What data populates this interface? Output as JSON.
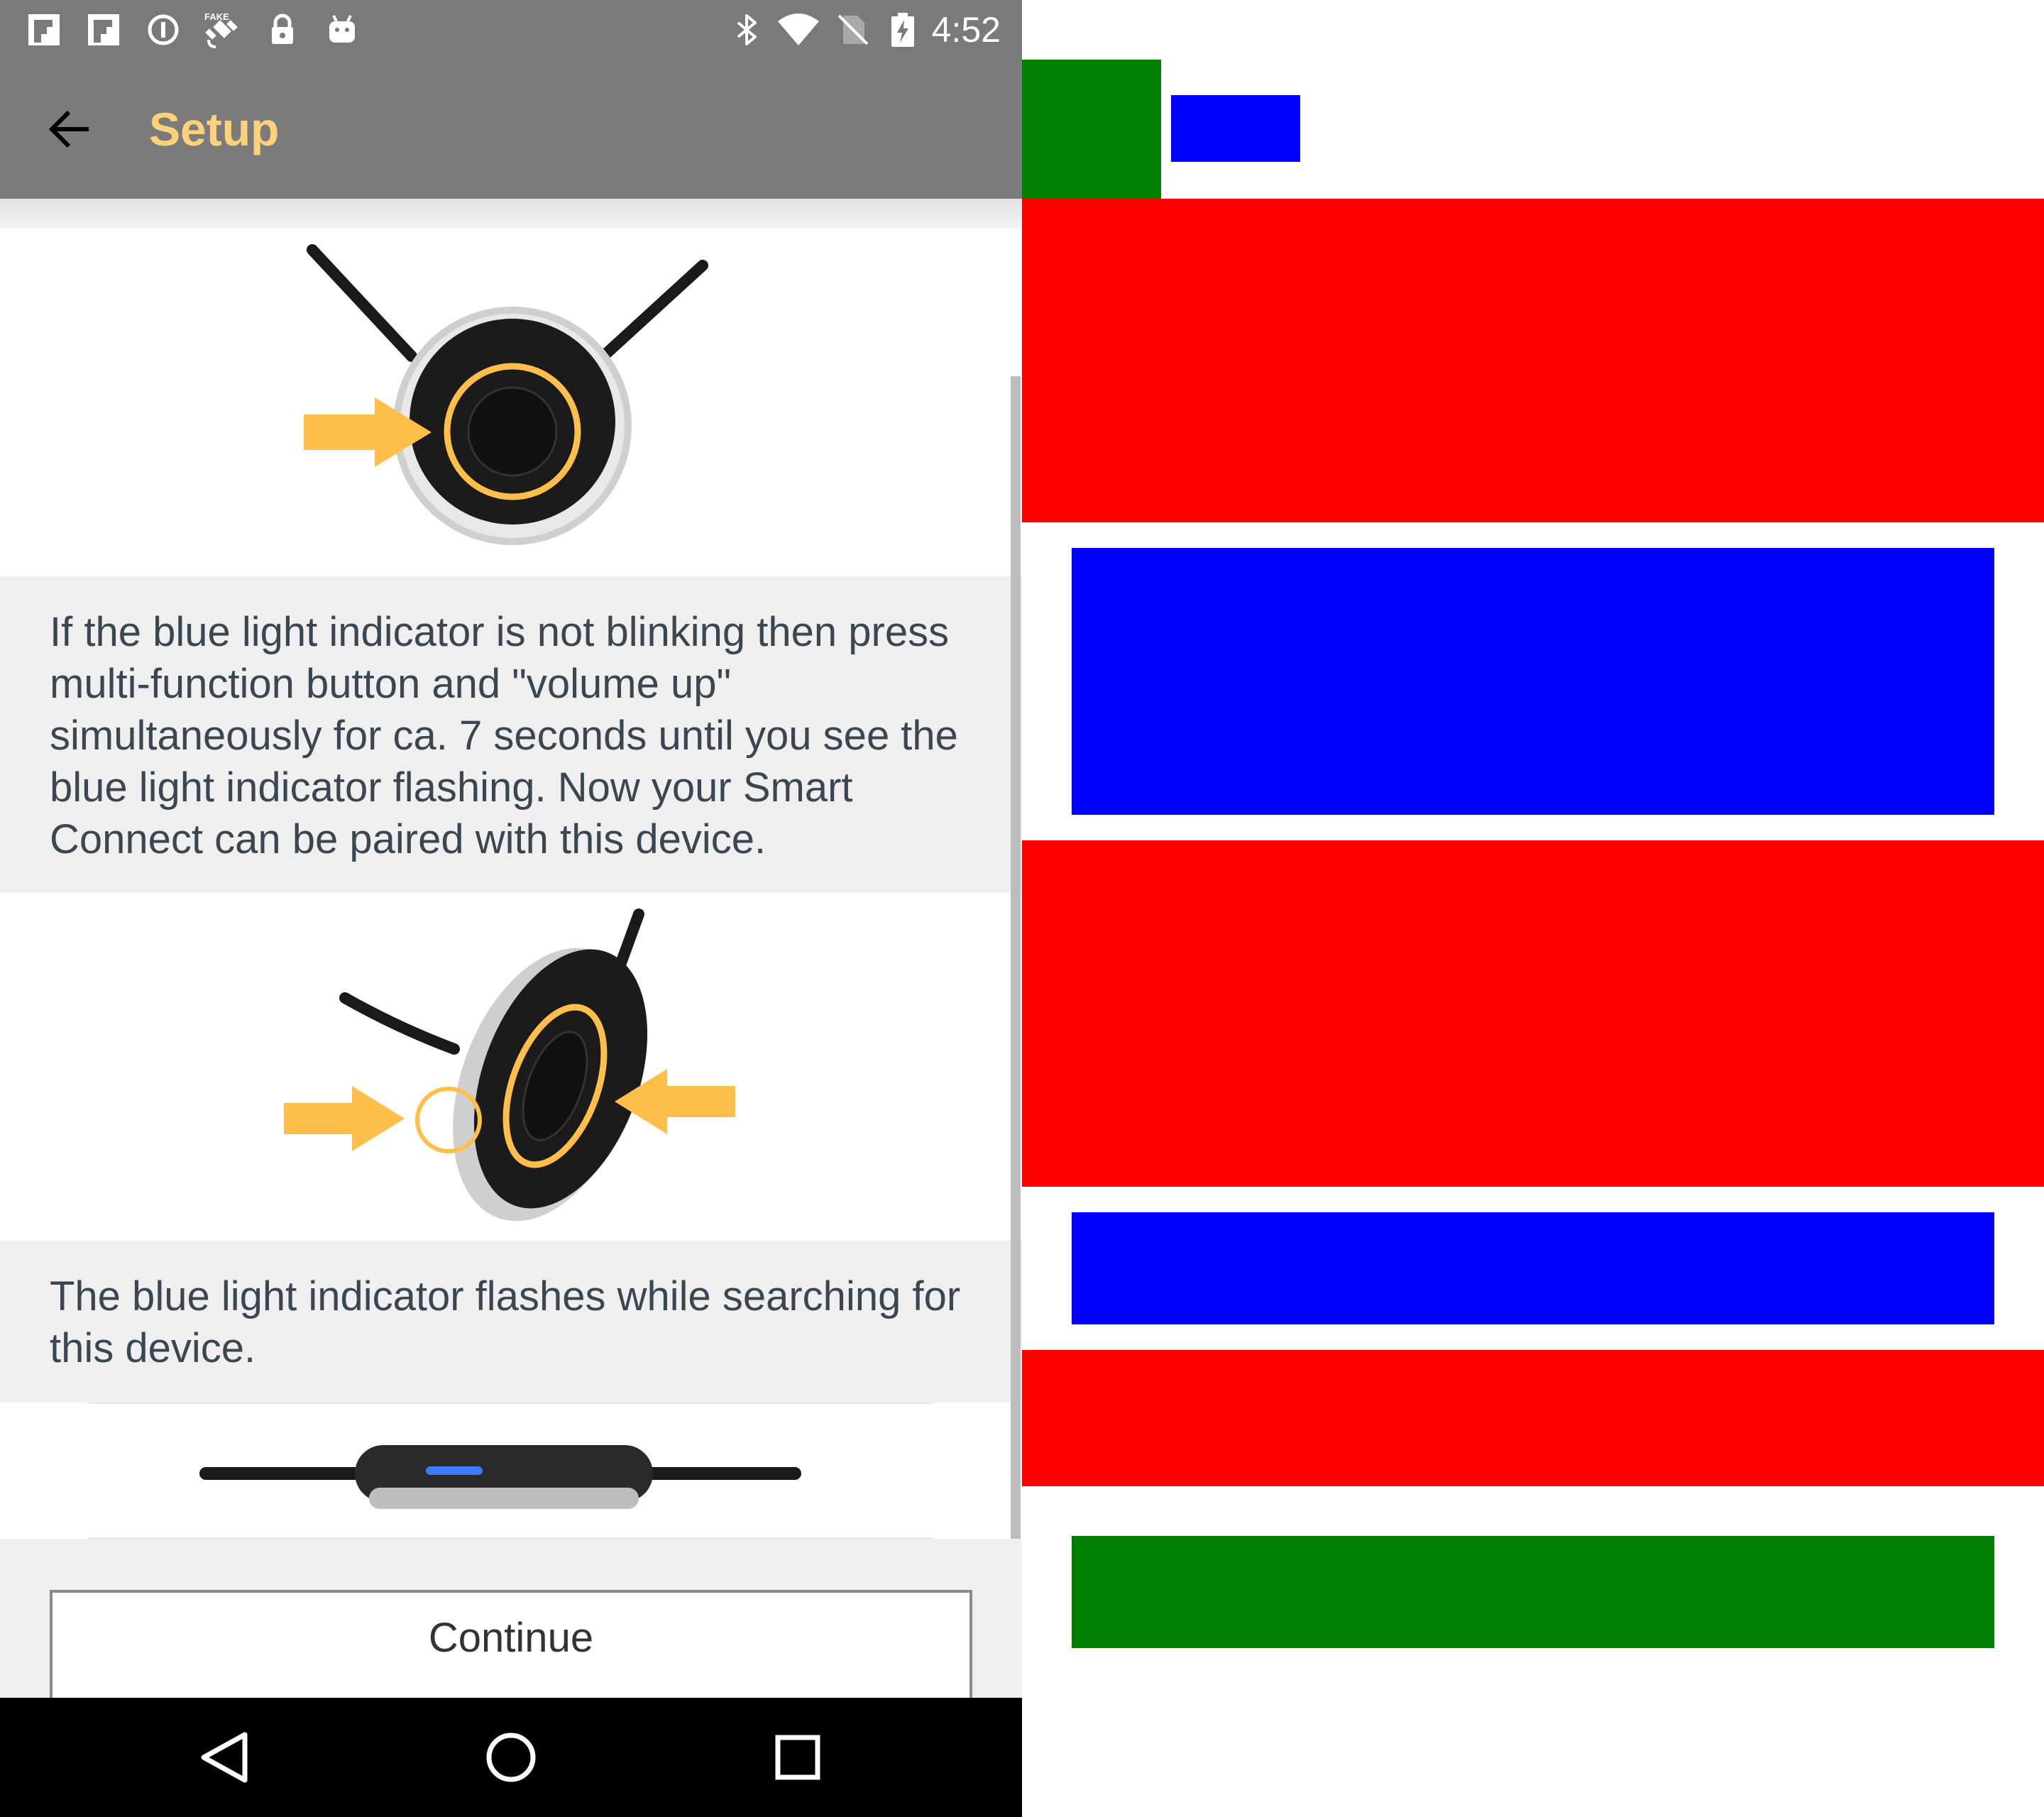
{
  "status_bar": {
    "time": "4:52",
    "left_icons": [
      "flipboard-icon",
      "flipboard-icon",
      "info-circle-icon",
      "fake-gps-icon",
      "lock-icon",
      "android-icon"
    ],
    "right_icons": [
      "bluetooth-icon",
      "wifi-icon",
      "no-sim-icon",
      "battery-charging-icon"
    ]
  },
  "app_bar": {
    "title": "Setup",
    "back_icon": "arrow-left-icon"
  },
  "steps": [
    {
      "image": "device-front-button-illustration"
    },
    {
      "text": "If the blue light indicator is not blinking then press multi-function button and \"volume up\" simultaneously for ca. 7 seconds until you see the blue light indicator flashing. Now your Smart Connect can be paired with this device."
    },
    {
      "image": "device-side-buttons-illustration"
    },
    {
      "text": "The blue light indicator flashes while searching for this device."
    },
    {
      "image": "device-blue-led-illustration"
    }
  ],
  "continue_button": {
    "label": "Continue"
  },
  "nav_bar": {
    "icons": [
      "back-triangle-icon",
      "home-circle-icon",
      "recents-square-icon"
    ]
  },
  "colors": {
    "app_bar_bg": "#7b7b7b",
    "title_color": "#ffd27a",
    "accent_orange": "#ffbf4a",
    "panel_bg": "#efefef",
    "text_color": "#3a4750",
    "annotation_green": "#008000",
    "annotation_blue": "#0000ff",
    "annotation_red": "#ff0000"
  }
}
